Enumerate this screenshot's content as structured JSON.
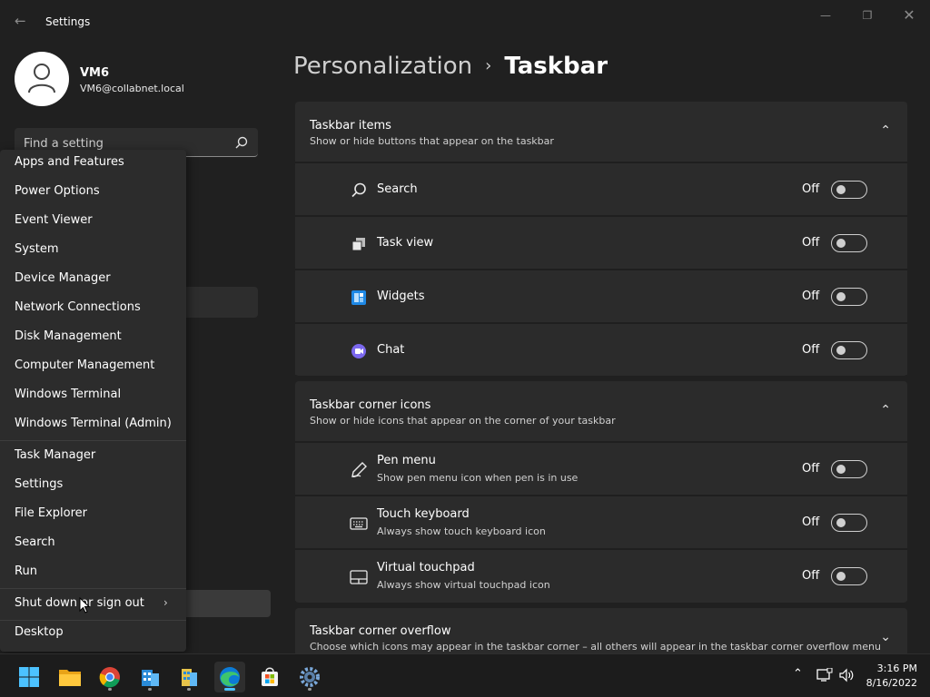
{
  "window": {
    "app_title": "Settings",
    "back_icon": "back-arrow-icon",
    "minimize_icon": "minimize-icon",
    "maximize_icon": "maximize-icon",
    "close_icon": "close-icon"
  },
  "profile": {
    "name": "VM6",
    "email": "VM6@collabnet.local"
  },
  "search": {
    "placeholder": "Find a setting"
  },
  "breadcrumb": {
    "parent": "Personalization",
    "separator": "›",
    "current": "Taskbar"
  },
  "sections": {
    "taskbar_items": {
      "title": "Taskbar items",
      "subtitle": "Show or hide buttons that appear on the taskbar",
      "expanded": true,
      "rows": [
        {
          "label": "Search",
          "state": "Off",
          "icon": "search-icon"
        },
        {
          "label": "Task view",
          "state": "Off",
          "icon": "task-view-icon"
        },
        {
          "label": "Widgets",
          "state": "Off",
          "icon": "widgets-icon"
        },
        {
          "label": "Chat",
          "state": "Off",
          "icon": "chat-icon"
        }
      ]
    },
    "corner_icons": {
      "title": "Taskbar corner icons",
      "subtitle": "Show or hide icons that appear on the corner of your taskbar",
      "expanded": true,
      "rows": [
        {
          "label": "Pen menu",
          "sub": "Show pen menu icon when pen is in use",
          "state": "Off",
          "icon": "pen-icon"
        },
        {
          "label": "Touch keyboard",
          "sub": "Always show touch keyboard icon",
          "state": "Off",
          "icon": "keyboard-icon"
        },
        {
          "label": "Virtual touchpad",
          "sub": "Always show virtual touchpad icon",
          "state": "Off",
          "icon": "touchpad-icon"
        }
      ]
    },
    "corner_overflow": {
      "title": "Taskbar corner overflow",
      "subtitle": "Choose which icons may appear in the taskbar corner – all others will appear in the taskbar corner overflow menu",
      "expanded": false
    }
  },
  "context_menu": {
    "items": [
      "Apps and Features",
      "Power Options",
      "Event Viewer",
      "System",
      "Device Manager",
      "Network Connections",
      "Disk Management",
      "Computer Management",
      "Windows Terminal",
      "Windows Terminal (Admin)",
      "Task Manager",
      "Settings",
      "File Explorer",
      "Search",
      "Run",
      "Shut down or sign out",
      "Desktop"
    ],
    "hovered_item": "Shut down or sign out"
  },
  "taskbar": {
    "apps": [
      {
        "name": "Start",
        "icon": "windows-logo-icon"
      },
      {
        "name": "File Explorer",
        "icon": "folder-icon"
      },
      {
        "name": "Chrome",
        "icon": "chrome-icon"
      },
      {
        "name": "Application",
        "icon": "building-app-icon"
      },
      {
        "name": "Application",
        "icon": "building-app-icon"
      },
      {
        "name": "Edge",
        "icon": "edge-icon"
      },
      {
        "name": "Microsoft Store",
        "icon": "store-icon"
      },
      {
        "name": "Settings",
        "icon": "gear-icon"
      }
    ],
    "time": "3:16 PM",
    "date": "8/16/2022"
  },
  "colors": {
    "background": "#202020",
    "card": "#2b2b2b",
    "menu": "#2c2c2c",
    "accent": "#4cc2ff"
  }
}
